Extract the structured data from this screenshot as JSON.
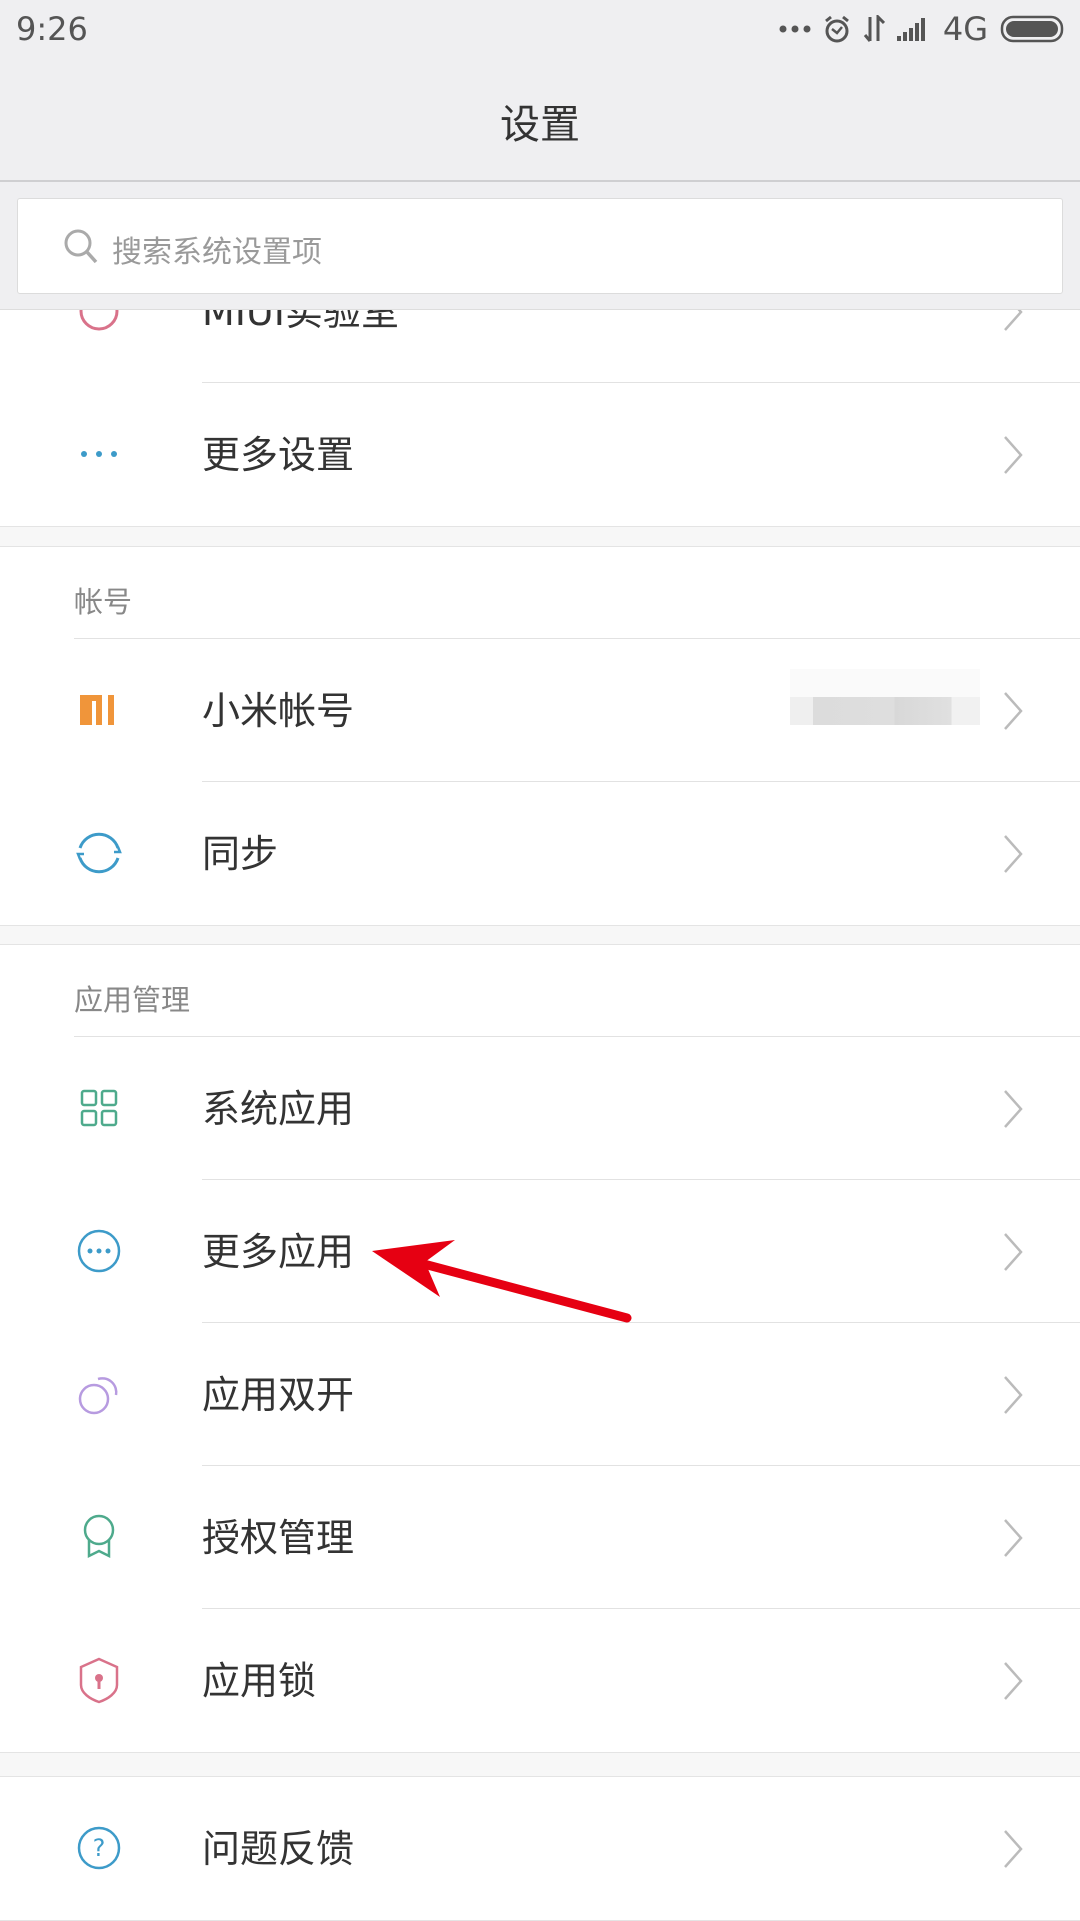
{
  "status_bar": {
    "time": "9:26",
    "network": "4G",
    "icons": [
      "more-dots-icon",
      "alarm-icon",
      "data-transfer-icon",
      "signal-icon",
      "battery-icon"
    ]
  },
  "header": {
    "title": "设置"
  },
  "search": {
    "placeholder": "搜索系统设置项",
    "value": ""
  },
  "groups": [
    {
      "items": [
        {
          "label": "MIUI实验室",
          "icon": "flask-icon"
        },
        {
          "label": "更多设置",
          "icon": "more-dots-icon"
        }
      ]
    },
    {
      "header": "帐号",
      "items": [
        {
          "label": "小米帐号",
          "icon": "mi-logo-icon",
          "value_blurred": true
        },
        {
          "label": "同步",
          "icon": "sync-icon"
        }
      ]
    },
    {
      "header": "应用管理",
      "items": [
        {
          "label": "系统应用",
          "icon": "grid-icon"
        },
        {
          "label": "更多应用",
          "icon": "more-circle-icon"
        },
        {
          "label": "应用双开",
          "icon": "dual-app-icon"
        },
        {
          "label": "授权管理",
          "icon": "badge-icon"
        },
        {
          "label": "应用锁",
          "icon": "shield-lock-icon"
        }
      ]
    },
    {
      "items": [
        {
          "label": "问题反馈",
          "icon": "help-circle-icon"
        }
      ]
    }
  ],
  "annotation": {
    "color": "#e60012",
    "points_to": "更多应用"
  },
  "colors": {
    "mi_orange": "#f0953a",
    "blue": "#3d9bc9",
    "green": "#4eaa8c",
    "purple": "#b79be0",
    "pink": "#d9728a"
  }
}
